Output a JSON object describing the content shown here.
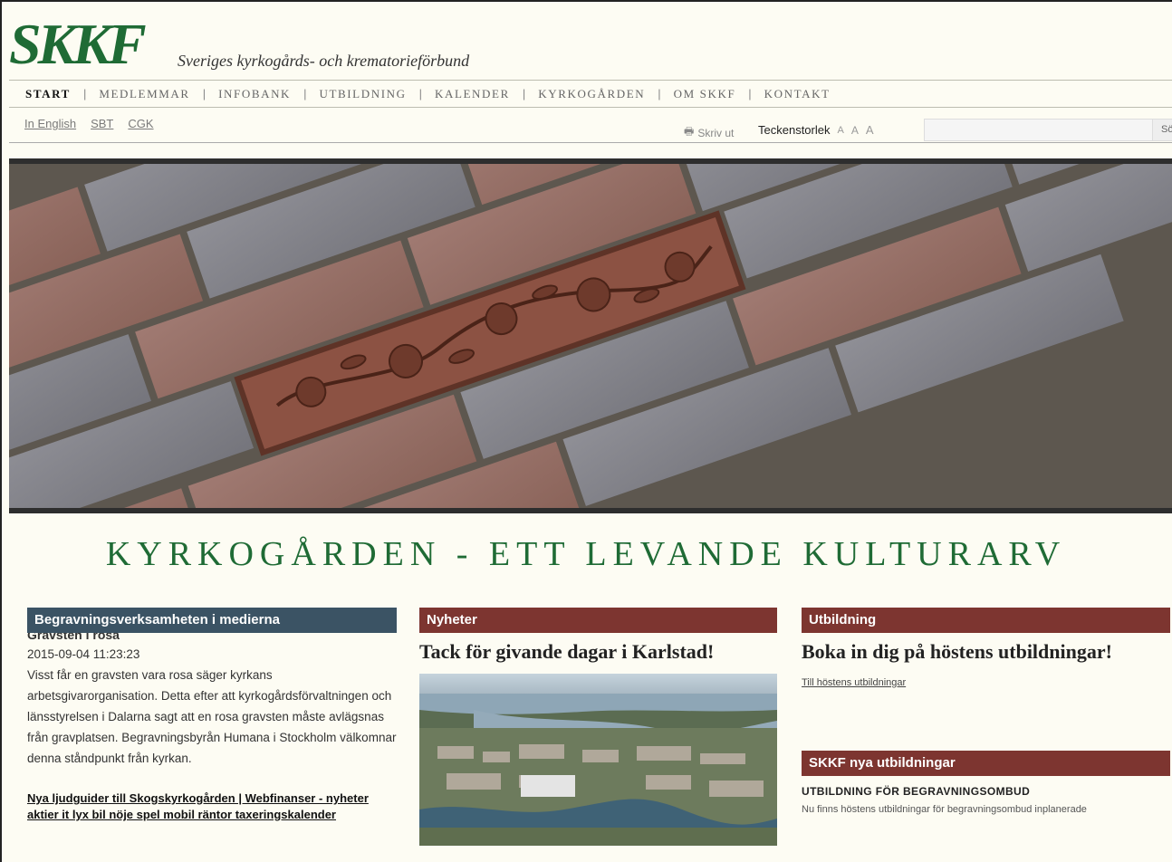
{
  "header": {
    "logo_text": "SKKF",
    "logo_subtitle": "Sveriges kyrkogårds- och krematorieförbund"
  },
  "nav": {
    "items": [
      {
        "label": "START"
      },
      {
        "label": "MEDLEMMAR"
      },
      {
        "label": "INFOBANK"
      },
      {
        "label": "UTBILDNING"
      },
      {
        "label": "KALENDER"
      },
      {
        "label": "KYRKOGÅRDEN"
      },
      {
        "label": "OM SKKF"
      },
      {
        "label": "KONTAKT"
      }
    ],
    "separator": "|"
  },
  "subbar": {
    "links": [
      "In English",
      "SBT",
      "CGK"
    ],
    "print_label": "Skriv ut",
    "textsize_label": "Teckenstorlek",
    "textsize_buttons": [
      "A",
      "A",
      "A"
    ],
    "search_button": "Sök"
  },
  "slogan": "KYRKOGÅRDEN - ETT LEVANDE KULTURARV",
  "col1": {
    "header": "Begravningsverksamheten i medierna",
    "cut_title": "Gravsten i rosa",
    "date": "2015-09-04 11:23:23",
    "text": "Visst får en gravsten vara rosa säger kyrkans arbetsgivarorganisation. Detta efter att kyrkogårdsförvaltningen och länsstyrelsen i Dalarna sagt att en rosa gravsten måste avlägsnas från gravplatsen. Begravningsbyrån Humana i Stockholm välkomnar denna ståndpunkt från kyrkan.",
    "link": "Nya ljudguider till Skogskyrkogården | Webfinanser - nyheter aktier it lyx bil nöje spel mobil räntor taxeringskalender"
  },
  "col2": {
    "header": "Nyheter",
    "title": "Tack för givande dagar i Karlstad!"
  },
  "col3": {
    "header": "Utbildning",
    "title": "Boka in dig på höstens utbildningar!",
    "link": "Till höstens utbildningar",
    "header2": "SKKF nya utbildningar",
    "item_title": "UTBILDNING FÖR BEGRAVNINGSOMBUD",
    "item_text": "Nu finns höstens utbildningar för begravningsombud inplanerade"
  },
  "colors": {
    "brand_green": "#1f6b35",
    "header_blue": "#3b5364",
    "header_red": "#7d3530"
  }
}
